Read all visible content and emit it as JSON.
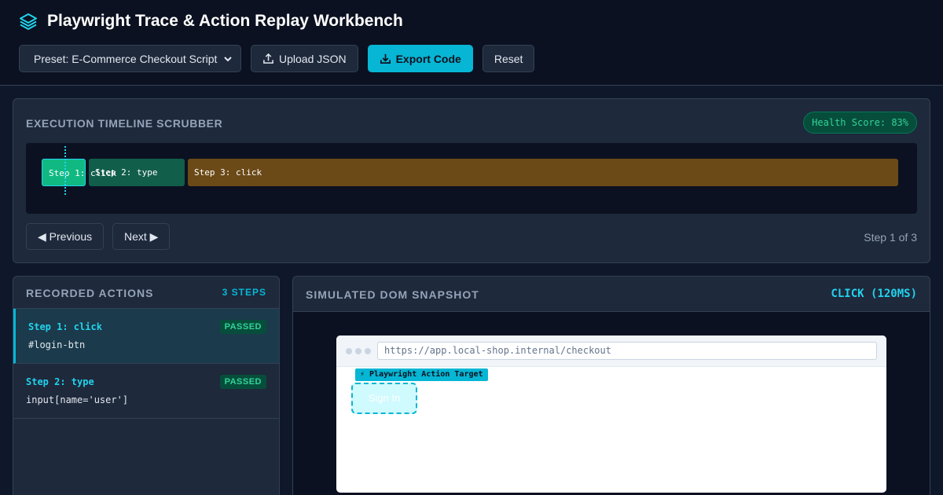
{
  "header": {
    "title": "Playwright Trace & Action Replay Workbench",
    "preset_label": "Preset: E-Commerce Checkout Script",
    "upload_label": "Upload JSON",
    "export_label": "Export Code",
    "reset_label": "Reset"
  },
  "timeline": {
    "title": "EXECUTION TIMELINE SCRUBBER",
    "health": "Health Score: 83%",
    "segments": [
      "Step 1: click",
      "Step 2: type",
      "Step 3: click"
    ],
    "prev_label": "◀ Previous",
    "next_label": "Next ▶",
    "counter": "Step 1 of 3"
  },
  "actions": {
    "title": "RECORDED ACTIONS",
    "count": "3 STEPS",
    "items": [
      {
        "name": "Step 1: click",
        "selector": "#login-btn",
        "status": "PASSED"
      },
      {
        "name": "Step 2: type",
        "selector": "input[name='user']",
        "status": "PASSED"
      }
    ]
  },
  "dom": {
    "title": "SIMULATED DOM SNAPSHOT",
    "meta": "CLICK (120MS)",
    "url": "https://app.local-shop.internal/checkout",
    "target_label": "⚡ Playwright Action Target",
    "button_label": "Sign In"
  },
  "colors": {
    "accent": "#06b6d4",
    "success": "#10b981",
    "warning_segment": "#6b4a18"
  }
}
